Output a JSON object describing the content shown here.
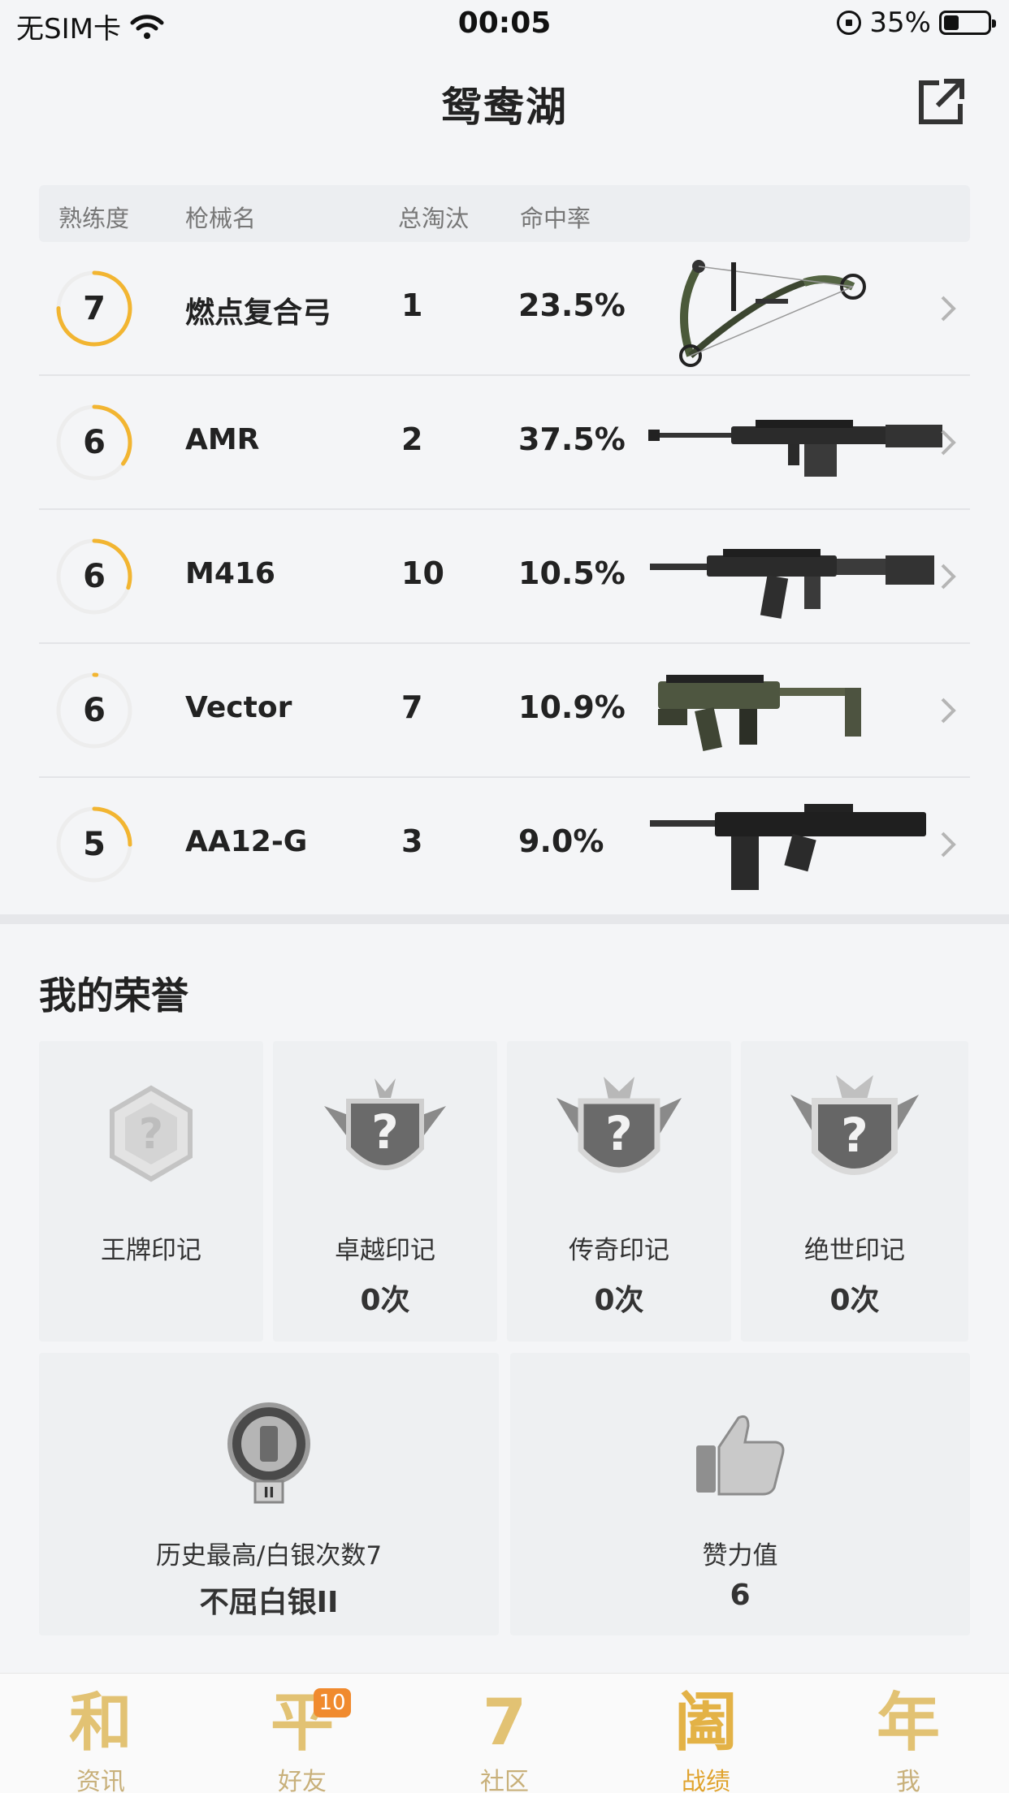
{
  "status_bar": {
    "carrier": "无SIM卡",
    "time": "00:05",
    "battery": "35%"
  },
  "header": {
    "title": "鸳鸯湖"
  },
  "table": {
    "headers": [
      "熟练度",
      "枪械名",
      "总淘汰",
      "命中率"
    ],
    "rows": [
      {
        "level": "7",
        "name": "燃点复合弓",
        "kills": "1",
        "rate": "23.5%",
        "progress": 0.75,
        "icon": "compound-bow"
      },
      {
        "level": "6",
        "name": "AMR",
        "kills": "2",
        "rate": "37.5%",
        "progress": 0.35,
        "icon": "sniper-rifle"
      },
      {
        "level": "6",
        "name": "M416",
        "kills": "10",
        "rate": "10.5%",
        "progress": 0.3,
        "icon": "assault-rifle"
      },
      {
        "level": "6",
        "name": "Vector",
        "kills": "7",
        "rate": "10.9%",
        "progress": 0.01,
        "icon": "smg"
      },
      {
        "level": "5",
        "name": "AA12-G",
        "kills": "3",
        "rate": "9.0%",
        "progress": 0.25,
        "icon": "shotgun"
      }
    ]
  },
  "honors": {
    "title": "我的荣誉",
    "marks": [
      {
        "label": "王牌印记",
        "value": ""
      },
      {
        "label": "卓越印记",
        "value": "0次"
      },
      {
        "label": "传奇印记",
        "value": "0次"
      },
      {
        "label": "绝世印记",
        "value": "0次"
      }
    ],
    "rank": {
      "label": "历史最高/白银次数7",
      "value": "不屈白银II"
    },
    "likes": {
      "label": "赞力值",
      "value": "6"
    }
  },
  "tabs": [
    {
      "glyph": "和",
      "label": "资讯"
    },
    {
      "glyph": "平",
      "label": "好友",
      "badge": "10"
    },
    {
      "glyph": "7",
      "label": "社区"
    },
    {
      "glyph": "阖",
      "label": "战绩",
      "active": true
    },
    {
      "glyph": "年",
      "label": "我"
    }
  ],
  "colors": {
    "accent": "#f2b531",
    "tab_gold": "#e2c273",
    "badge_orange": "#f08a2e"
  }
}
